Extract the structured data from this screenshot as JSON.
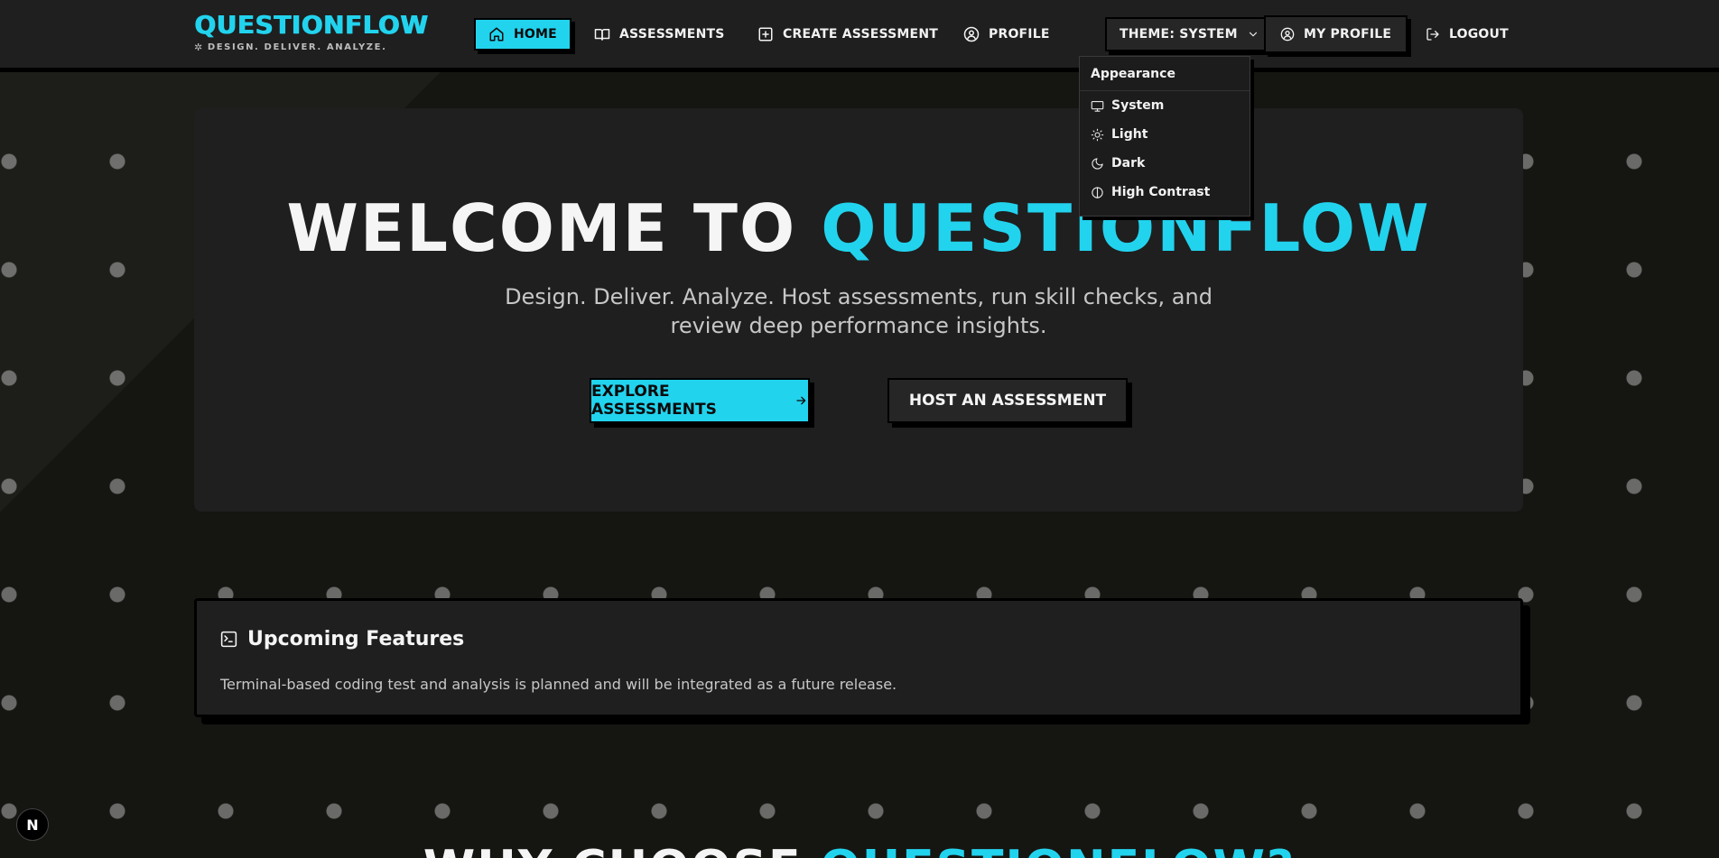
{
  "brand": {
    "title": "QUESTIONFLOW",
    "tagline": "DESIGN. DELIVER. ANALYZE."
  },
  "nav": {
    "home": "HOME",
    "assessments": "ASSESSMENTS",
    "create": "CREATE ASSESSMENT",
    "profile": "PROFILE",
    "theme": "THEME: SYSTEM",
    "my_profile": "MY PROFILE",
    "logout": "LOGOUT"
  },
  "theme_menu": {
    "heading": "Appearance",
    "items": [
      {
        "label": "System",
        "icon": "monitor-icon"
      },
      {
        "label": "Light",
        "icon": "sun-icon"
      },
      {
        "label": "Dark",
        "icon": "moon-icon"
      },
      {
        "label": "High Contrast",
        "icon": "contrast-icon"
      }
    ]
  },
  "hero": {
    "title_part1": "WELCOME TO ",
    "title_part2": "QUESTIONFLOW",
    "subtitle": "Design. Deliver. Analyze. Host assessments, run skill checks, and review deep performance insights.",
    "explore_label": "EXPLORE ASSESSMENTS",
    "host_label": "HOST AN ASSESSMENT"
  },
  "features": {
    "title": "Upcoming Features",
    "description": "Terminal-based coding test and analysis is planned and will be integrated as a future release."
  },
  "why": {
    "part1": "WHY CHOOSE ",
    "part2": "QUESTIONFLOW?"
  },
  "badge": {
    "label": "N"
  },
  "colors": {
    "accent": "#22d3ee",
    "background": "#151512",
    "surface": "#1f1f1f",
    "text": "#f2f2f2"
  }
}
